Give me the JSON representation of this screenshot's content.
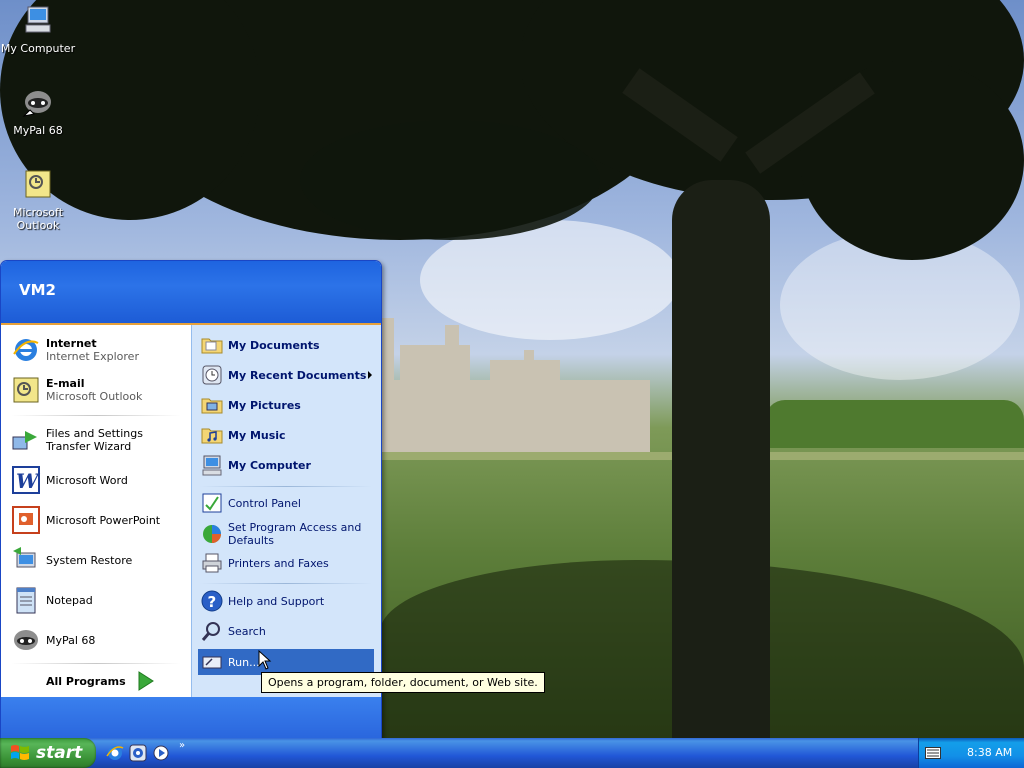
{
  "desktop": {
    "icons": [
      {
        "label": "My Computer"
      },
      {
        "label": "MyPal 68"
      },
      {
        "label": "Microsoft Outlook"
      }
    ]
  },
  "start_menu": {
    "user": "VM2",
    "left": {
      "pinned": [
        {
          "title": "Internet",
          "subtitle": "Internet Explorer"
        },
        {
          "title": "E-mail",
          "subtitle": "Microsoft Outlook"
        }
      ],
      "recent": [
        {
          "label": "Files and Settings Transfer Wizard"
        },
        {
          "label": "Microsoft Word"
        },
        {
          "label": "Microsoft PowerPoint"
        },
        {
          "label": "System Restore"
        },
        {
          "label": "Notepad"
        },
        {
          "label": "MyPal 68"
        }
      ],
      "all_programs": "All Programs"
    },
    "right": {
      "places": [
        {
          "label": "My Documents"
        },
        {
          "label": "My Recent Documents"
        },
        {
          "label": "My Pictures"
        },
        {
          "label": "My Music"
        },
        {
          "label": "My Computer"
        }
      ],
      "settings": [
        {
          "label": "Control Panel"
        },
        {
          "label": "Set Program Access and Defaults"
        },
        {
          "label": "Printers and Faxes"
        }
      ],
      "tools": [
        {
          "label": "Help and Support"
        },
        {
          "label": "Search"
        },
        {
          "label": "Run..."
        }
      ]
    }
  },
  "tooltip": "Opens a program, folder, document, or Web site.",
  "taskbar": {
    "start_label": "start",
    "clock": "8:38 AM"
  },
  "colors": {
    "taskbar_blue": "#2157d7",
    "start_green": "#3a9236",
    "menu_highlight": "#316ac5",
    "tooltip_bg": "#ffffe1"
  }
}
